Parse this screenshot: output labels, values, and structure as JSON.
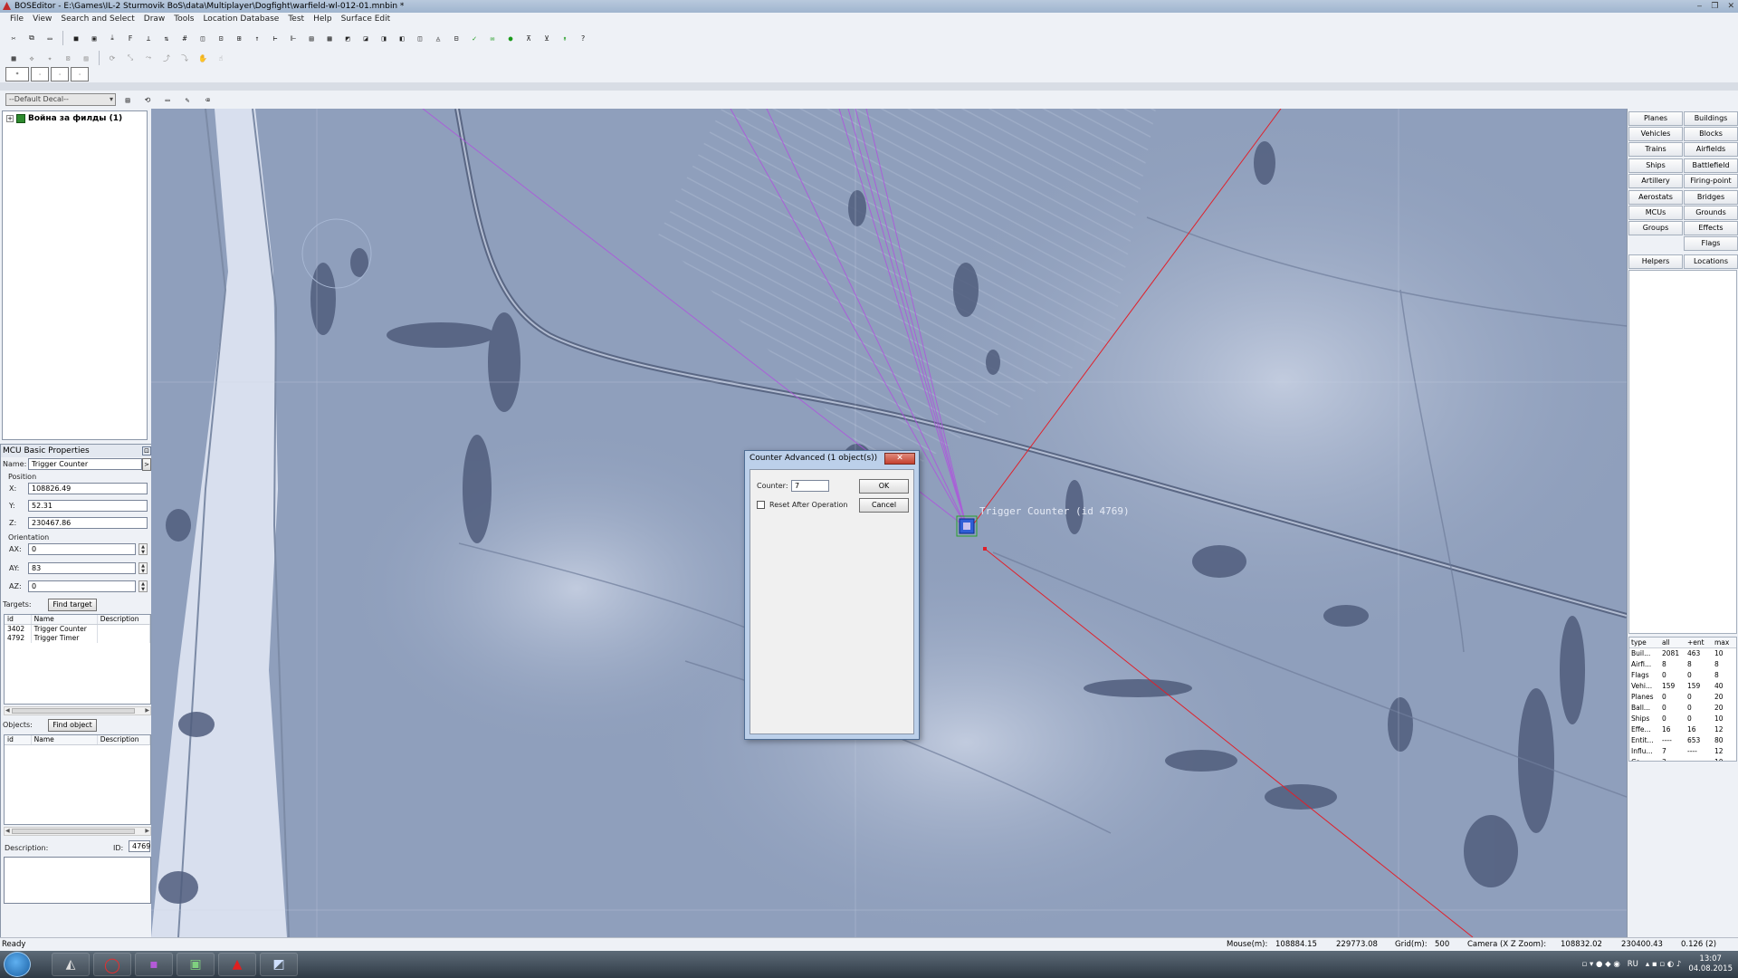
{
  "window": {
    "title": "BOSEditor - E:\\Games\\IL-2 Sturmovik BoS\\data\\Multiplayer\\Dogfight\\warfield-wl-012-01.mnbin *",
    "controls": [
      "‒",
      "❐",
      "✕"
    ]
  },
  "menu": [
    "File",
    "View",
    "Search and Select",
    "Draw",
    "Tools",
    "Location Database",
    "Test",
    "Help",
    "Surface Edit"
  ],
  "decal_select": "--Default Decal--",
  "tree": {
    "root_label": "Война за филды (1)"
  },
  "props": {
    "header": "MCU Basic Properties",
    "name_label": "Name:",
    "name_value": "Trigger Counter",
    "position_label": "Position",
    "x_label": "X:",
    "x_value": "108826.49",
    "y_label": "Y:",
    "y_value": "52.31",
    "z_label": "Z:",
    "z_value": "230467.86",
    "orientation_label": "Orientation",
    "ax_label": "AX:",
    "ax_value": "0",
    "ay_label": "AY:",
    "ay_value": "83",
    "az_label": "AZ:",
    "az_value": "0",
    "targets_label": "Targets:",
    "find_target": "Find target",
    "objects_label": "Objects:",
    "find_object": "Find object",
    "col_id": "id",
    "col_name": "Name",
    "col_desc": "Description",
    "targets": [
      {
        "id": "3402",
        "name": "Trigger Counter"
      },
      {
        "id": "4792",
        "name": "Trigger Timer"
      }
    ],
    "description_label": "Description:",
    "id_label": "ID:",
    "id_value": "4769"
  },
  "dialog": {
    "title": "Counter Advanced (1 object(s))",
    "close": "✕",
    "counter_label": "Counter:",
    "counter_value": "7",
    "ok": "OK",
    "cancel": "Cancel",
    "reset_label": "Reset After Operation",
    "reset_checked": false
  },
  "map": {
    "mcu_label": "Trigger Counter (id 4769)"
  },
  "categories": [
    [
      "Planes",
      "Buildings"
    ],
    [
      "Vehicles",
      "Blocks"
    ],
    [
      "Trains",
      "Airfields"
    ],
    [
      "Ships",
      "Battlefield"
    ],
    [
      "Artillery",
      "Firing-point"
    ],
    [
      "Aerostats",
      "Bridges"
    ],
    [
      "MCUs",
      "Grounds"
    ],
    [
      "Groups",
      "Effects"
    ],
    [
      "",
      "Flags"
    ],
    [
      "Helpers",
      "Locations"
    ]
  ],
  "stats": {
    "headers": [
      "type",
      "all",
      "+ent",
      "max"
    ],
    "rows": [
      [
        "Buil...",
        "2081",
        "463",
        "10"
      ],
      [
        "Airfi...",
        "8",
        "8",
        "8"
      ],
      [
        "Flags",
        "0",
        "0",
        "8"
      ],
      [
        "Vehi...",
        "159",
        "159",
        "40"
      ],
      [
        "Planes",
        "0",
        "0",
        "20"
      ],
      [
        "Ball...",
        "0",
        "0",
        "20"
      ],
      [
        "Ships",
        "0",
        "0",
        "10"
      ],
      [
        "Effe...",
        "16",
        "16",
        "12"
      ],
      [
        "Entit...",
        "----",
        "653",
        "80"
      ],
      [
        "Influ...",
        "7",
        "----",
        "12"
      ],
      [
        "Co...",
        "3",
        "",
        "10"
      ]
    ]
  },
  "status": {
    "ready": "Ready",
    "mouse_label": "Mouse(m):",
    "mouse_x": "108884.15",
    "mouse_z": "229773.08",
    "grid_label": "Grid(m):",
    "grid_value": "500",
    "camera_label": "Camera (X Z Zoom):",
    "camera_x": "108832.02",
    "camera_z": "230400.43",
    "camera_zoom": "0.126 (2)"
  },
  "tray": {
    "lang": "RU",
    "time": "13:07",
    "date": "04.08.2015"
  },
  "colors": {
    "map_base": "#8f9fbc",
    "river": "#d8dfee",
    "red_line": "#e0202a",
    "purple_line": "#b050e0",
    "mcu_box": "#2f5fd6"
  }
}
